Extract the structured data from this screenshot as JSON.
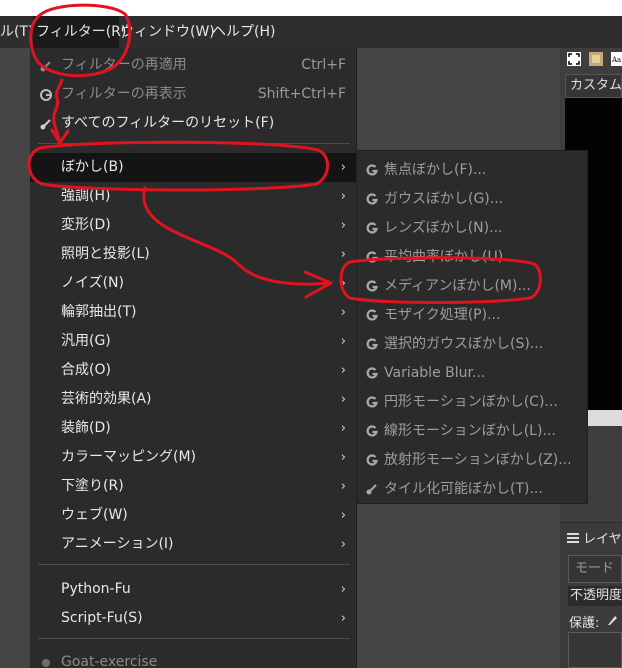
{
  "menubar": {
    "items": [
      {
        "label": "ル(T)"
      },
      {
        "label": "フィルター(R)"
      },
      {
        "label": "ウィンドウ(W)"
      },
      {
        "label": "ヘルプ(H)"
      }
    ]
  },
  "right_panel": {
    "canvas_tab": "カスタム",
    "layers_title": "レイヤ",
    "mode_placeholder": "モード",
    "opacity_label": "不透明度",
    "protect_label": "保護:"
  },
  "filters_menu": {
    "items": [
      {
        "label": "フィルターの再適用",
        "shortcut": "Ctrl+F",
        "icon": "reapply-filter-icon"
      },
      {
        "label": "フィルターの再表示",
        "shortcut": "Shift+Ctrl+F",
        "icon": "reshow-filter-icon"
      },
      {
        "label": "すべてのフィルターのリセット(F)",
        "icon": "reset-filters-icon"
      },
      {
        "label": "ぼかし(B)"
      },
      {
        "label": "強調(H)"
      },
      {
        "label": "変形(D)"
      },
      {
        "label": "照明と投影(L)"
      },
      {
        "label": "ノイズ(N)"
      },
      {
        "label": "輪郭抽出(T)"
      },
      {
        "label": "汎用(G)"
      },
      {
        "label": "合成(O)"
      },
      {
        "label": "芸術的効果(A)"
      },
      {
        "label": "装飾(D)"
      },
      {
        "label": "カラーマッピング(M)"
      },
      {
        "label": "下塗り(R)"
      },
      {
        "label": "ウェブ(W)"
      },
      {
        "label": "アニメーション(I)"
      },
      {
        "label": "Python-Fu"
      },
      {
        "label": "Script-Fu(S)"
      },
      {
        "label": "Goat-exercise"
      }
    ],
    "submenu_arrow": "›"
  },
  "blur_submenu": {
    "items": [
      {
        "label": "焦点ぼかし(F)...",
        "icon": "gegl-icon"
      },
      {
        "label": "ガウスぼかし(G)...",
        "icon": "gegl-icon"
      },
      {
        "label": "レンズぼかし(N)...",
        "icon": "gegl-icon"
      },
      {
        "label": "平均曲率ぼかし(U)...",
        "icon": "gegl-icon"
      },
      {
        "label": "メディアンぼかし(M)...",
        "icon": "gegl-icon"
      },
      {
        "label": "モザイク処理(P)...",
        "icon": "gegl-icon"
      },
      {
        "label": "選択的ガウスぼかし(S)...",
        "icon": "gegl-icon"
      },
      {
        "label": "Variable Blur...",
        "icon": "gegl-icon"
      },
      {
        "label": "円形モーションぼかし(C)...",
        "icon": "gegl-icon"
      },
      {
        "label": "線形モーションぼかし(L)...",
        "icon": "gegl-icon"
      },
      {
        "label": "放射形モーションぼかし(Z)...",
        "icon": "gegl-icon"
      },
      {
        "label": "タイル化可能ぼかし(T)...",
        "icon": "script-fu-icon"
      }
    ]
  },
  "colors": {
    "menu_bg": "#2b2b2b",
    "highlight_bg": "#141414",
    "annotation_red": "#e0141e"
  }
}
